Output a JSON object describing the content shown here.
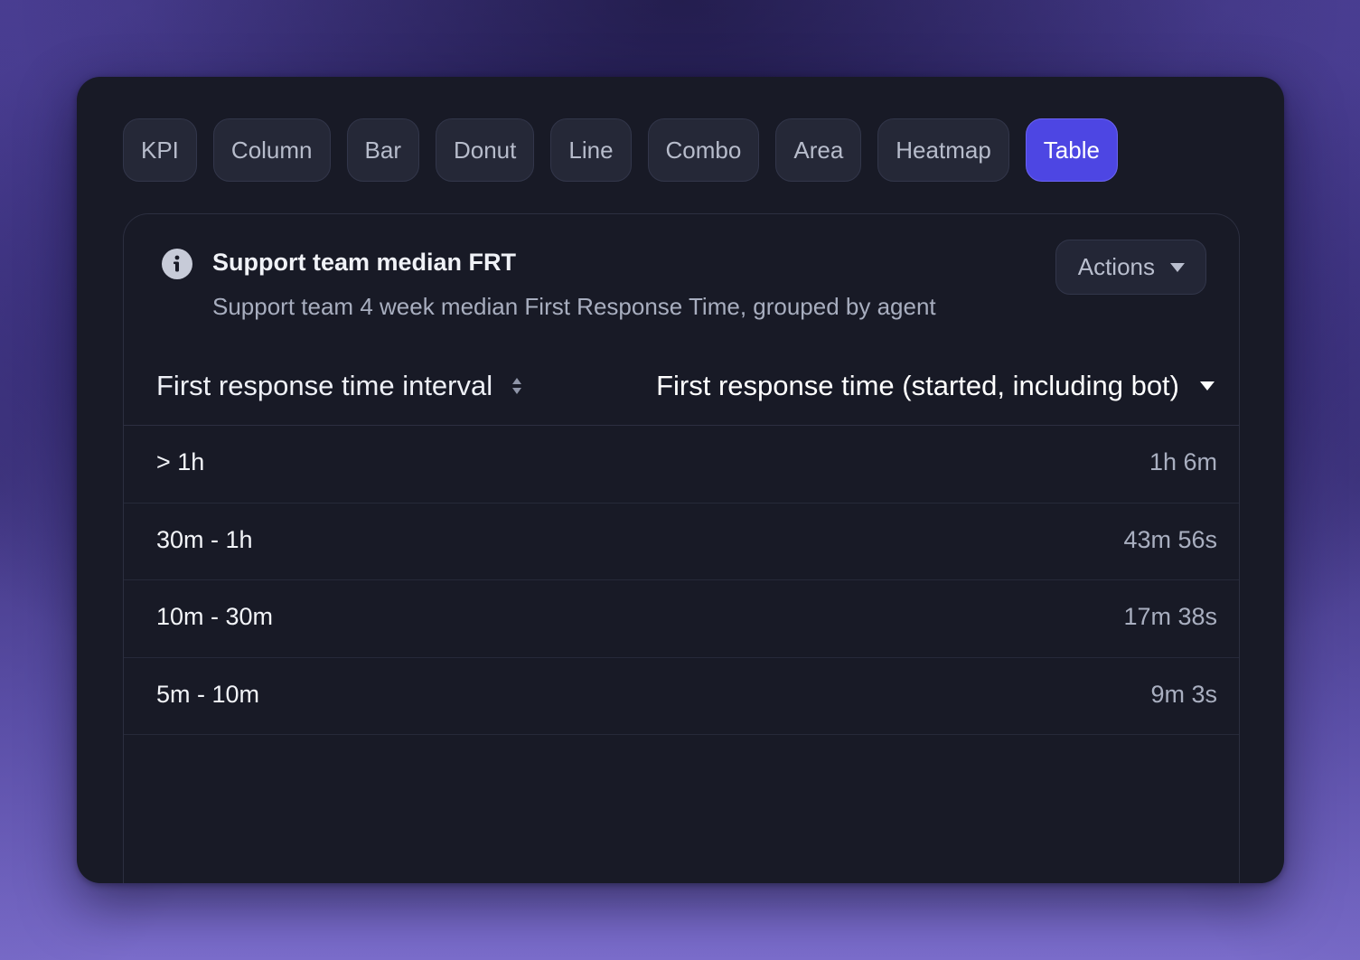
{
  "tabs": [
    {
      "label": "KPI",
      "active": false
    },
    {
      "label": "Column",
      "active": false
    },
    {
      "label": "Bar",
      "active": false
    },
    {
      "label": "Donut",
      "active": false
    },
    {
      "label": "Line",
      "active": false
    },
    {
      "label": "Combo",
      "active": false
    },
    {
      "label": "Area",
      "active": false
    },
    {
      "label": "Heatmap",
      "active": false
    },
    {
      "label": "Table",
      "active": true
    }
  ],
  "panel": {
    "title": "Support team median FRT",
    "subtitle": "Support team 4 week median First Response Time, grouped by agent",
    "actions_label": "Actions",
    "info_icon": "info-icon"
  },
  "table": {
    "columns": [
      {
        "label": "First response time interval",
        "icon": "sort-icon"
      },
      {
        "label": "First response time (started, including bot)",
        "icon": "caret-down-icon"
      }
    ],
    "rows": [
      {
        "interval": "> 1h",
        "value": "1h 6m"
      },
      {
        "interval": "30m - 1h",
        "value": "43m 56s"
      },
      {
        "interval": "10m - 30m",
        "value": "17m 38s"
      },
      {
        "interval": "5m - 10m",
        "value": "9m 3s"
      }
    ]
  },
  "colors": {
    "accent": "#4d46e3",
    "window_bg": "#181a26",
    "tab_bg": "#252837"
  }
}
